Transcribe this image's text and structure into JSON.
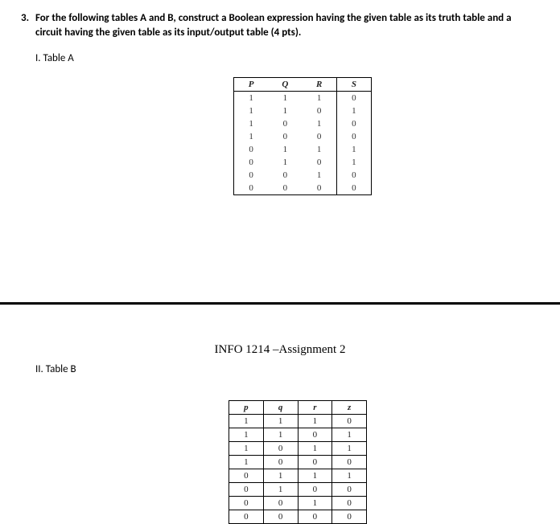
{
  "question": {
    "number": "3.",
    "text": "For the following tables A and B, construct a Boolean expression having the given table as its truth table and a circuit having the given table as its input/output table (4 pts)."
  },
  "sectionA": {
    "label": "I. Table A"
  },
  "sectionB": {
    "label": "II. Table B"
  },
  "assignmentTitle": "INFO 1214 –Assignment 2",
  "tableA": {
    "headers": {
      "c0": "P",
      "c1": "Q",
      "c2": "R",
      "c3": "S"
    },
    "rows": {
      "r0": {
        "c0": "1",
        "c1": "1",
        "c2": "1",
        "c3": "0"
      },
      "r1": {
        "c0": "1",
        "c1": "1",
        "c2": "0",
        "c3": "1"
      },
      "r2": {
        "c0": "1",
        "c1": "0",
        "c2": "1",
        "c3": "0"
      },
      "r3": {
        "c0": "1",
        "c1": "0",
        "c2": "0",
        "c3": "0"
      },
      "r4": {
        "c0": "0",
        "c1": "1",
        "c2": "1",
        "c3": "1"
      },
      "r5": {
        "c0": "0",
        "c1": "1",
        "c2": "0",
        "c3": "1"
      },
      "r6": {
        "c0": "0",
        "c1": "0",
        "c2": "1",
        "c3": "0"
      },
      "r7": {
        "c0": "0",
        "c1": "0",
        "c2": "0",
        "c3": "0"
      }
    }
  },
  "tableB": {
    "headers": {
      "c0": "p",
      "c1": "q",
      "c2": "r",
      "c3": "z"
    },
    "rows": {
      "r0": {
        "c0": "1",
        "c1": "1",
        "c2": "1",
        "c3": "0"
      },
      "r1": {
        "c0": "1",
        "c1": "1",
        "c2": "0",
        "c3": "1"
      },
      "r2": {
        "c0": "1",
        "c1": "0",
        "c2": "1",
        "c3": "1"
      },
      "r3": {
        "c0": "1",
        "c1": "0",
        "c2": "0",
        "c3": "0"
      },
      "r4": {
        "c0": "0",
        "c1": "1",
        "c2": "1",
        "c3": "1"
      },
      "r5": {
        "c0": "0",
        "c1": "1",
        "c2": "0",
        "c3": "0"
      },
      "r6": {
        "c0": "0",
        "c1": "0",
        "c2": "1",
        "c3": "0"
      },
      "r7": {
        "c0": "0",
        "c1": "0",
        "c2": "0",
        "c3": "0"
      }
    }
  }
}
